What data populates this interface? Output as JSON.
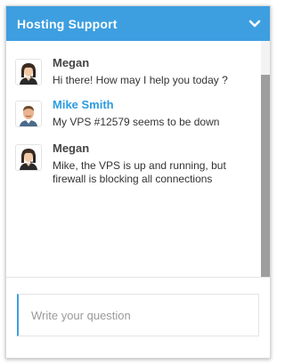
{
  "header": {
    "title": "Hosting Support",
    "toggle_icon": "chevron-down-icon",
    "background": "#3d9fe0"
  },
  "messages": [
    {
      "sender": "Megan",
      "text": "Hi there! How may I help you today ?",
      "avatar": "female-agent-avatar",
      "name_color": "#444444"
    },
    {
      "sender": "Mike Smith",
      "text": "My VPS #12579 seems to be down",
      "avatar": "male-user-avatar",
      "name_color": "#2c9ce0"
    },
    {
      "sender": "Megan",
      "text": "Mike, the VPS is up and running, but firewall is blocking all connections",
      "avatar": "female-agent-avatar",
      "name_color": "#444444"
    }
  ],
  "composer": {
    "placeholder": "Write your question",
    "value": ""
  }
}
